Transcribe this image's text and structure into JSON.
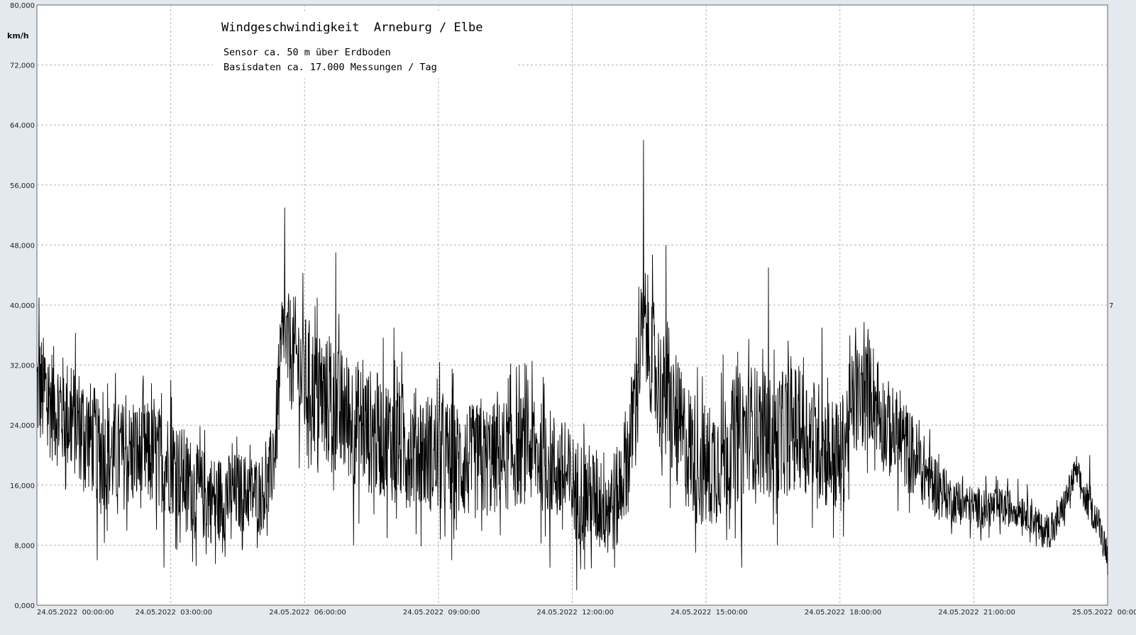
{
  "chart_data": {
    "type": "line",
    "title": "Windgeschwindigkeit  Arneburg / Elbe",
    "subtitle_lines": [
      "Sensor ca. 50 m über Erdboden",
      "Basisdaten ca. 17.000 Messungen / Tag"
    ],
    "ylabel": "km/h",
    "xlabel": "",
    "ylim": [
      0,
      80
    ],
    "xlim": [
      0,
      24
    ],
    "grid": true,
    "y_ticks": [
      {
        "value": 0,
        "label": "0,000"
      },
      {
        "value": 8,
        "label": "8,000"
      },
      {
        "value": 16,
        "label": "16,000"
      },
      {
        "value": 24,
        "label": "24,000"
      },
      {
        "value": 32,
        "label": "32,000"
      },
      {
        "value": 40,
        "label": "40,000"
      },
      {
        "value": 48,
        "label": "48,000"
      },
      {
        "value": 56,
        "label": "56,000"
      },
      {
        "value": 64,
        "label": "64,000"
      },
      {
        "value": 72,
        "label": "72,000"
      },
      {
        "value": 80,
        "label": "80,000"
      }
    ],
    "x_ticks": [
      {
        "value": 0,
        "label": "24.05.2022  00:00:00"
      },
      {
        "value": 3,
        "label": "24.05.2022  03:00:00"
      },
      {
        "value": 6,
        "label": "24.05.2022  06:00:00"
      },
      {
        "value": 9,
        "label": "24.05.2022  09:00:00"
      },
      {
        "value": 12,
        "label": "24.05.2022  12:00:00"
      },
      {
        "value": 15,
        "label": "24.05.2022  15:00:00"
      },
      {
        "value": 18,
        "label": "24.05.2022  18:00:00"
      },
      {
        "value": 21,
        "label": "24.05.2022  21:00:00"
      },
      {
        "value": 24,
        "label": "25.05.2022  00:00:00"
      }
    ],
    "right_edge_label": "7",
    "series": [
      {
        "line_color": "#000000",
        "trend": {
          "x": [
            0,
            0.5,
            1,
            1.5,
            2,
            2.5,
            3,
            3.3,
            3.6,
            4,
            4.5,
            5,
            5.2,
            5.35,
            5.5,
            5.8,
            6,
            6.5,
            7,
            7.5,
            8,
            8.5,
            9,
            9.5,
            10,
            10.5,
            11,
            11.5,
            12,
            12.5,
            13,
            13.3,
            13.6,
            14,
            14.5,
            15,
            15.5,
            16,
            16.5,
            17,
            17.5,
            18,
            18.3,
            18.7,
            19,
            19.5,
            20,
            20.5,
            21,
            21.5,
            22,
            22.3,
            22.5,
            22.8,
            23,
            23.3,
            23.5,
            23.8,
            24
          ],
          "y": [
            29,
            26,
            24,
            20,
            20,
            20,
            19,
            17,
            15,
            14,
            15,
            15,
            16,
            22,
            35,
            33,
            30,
            27,
            25,
            23,
            22,
            21,
            20,
            19,
            19,
            20,
            21,
            19,
            16,
            14,
            14,
            22,
            38,
            28,
            22,
            18,
            21,
            24,
            22,
            24,
            22,
            19,
            27,
            29,
            24,
            21,
            17,
            14,
            13,
            13,
            13,
            12,
            10,
            10,
            13,
            18,
            14,
            11,
            7
          ]
        },
        "spikes": [
          {
            "x": 0.05,
            "y": 41
          },
          {
            "x": 1.35,
            "y": 6
          },
          {
            "x": 2.85,
            "y": 5
          },
          {
            "x": 3.0,
            "y": 30
          },
          {
            "x": 4.0,
            "y": 5.5
          },
          {
            "x": 5.55,
            "y": 53
          },
          {
            "x": 6.7,
            "y": 47
          },
          {
            "x": 7.1,
            "y": 8
          },
          {
            "x": 8.0,
            "y": 37
          },
          {
            "x": 9.3,
            "y": 6
          },
          {
            "x": 11.0,
            "y": 30
          },
          {
            "x": 11.5,
            "y": 5
          },
          {
            "x": 12.1,
            "y": 2
          },
          {
            "x": 12.8,
            "y": 7
          },
          {
            "x": 13.6,
            "y": 62
          },
          {
            "x": 14.1,
            "y": 48
          },
          {
            "x": 15.8,
            "y": 5
          },
          {
            "x": 16.4,
            "y": 45
          },
          {
            "x": 16.6,
            "y": 8
          },
          {
            "x": 17.6,
            "y": 37
          },
          {
            "x": 18.35,
            "y": 37
          },
          {
            "x": 23.6,
            "y": 20
          },
          {
            "x": 24.0,
            "y": 4
          }
        ],
        "noise_amplitude": [
          {
            "x": 0,
            "a": 8
          },
          {
            "x": 3,
            "a": 7
          },
          {
            "x": 5,
            "a": 5
          },
          {
            "x": 6,
            "a": 9
          },
          {
            "x": 9,
            "a": 8
          },
          {
            "x": 13,
            "a": 7
          },
          {
            "x": 14,
            "a": 9
          },
          {
            "x": 18,
            "a": 8
          },
          {
            "x": 19.5,
            "a": 6
          },
          {
            "x": 20.5,
            "a": 3
          },
          {
            "x": 22,
            "a": 2.5
          },
          {
            "x": 24,
            "a": 2
          }
        ]
      }
    ]
  }
}
